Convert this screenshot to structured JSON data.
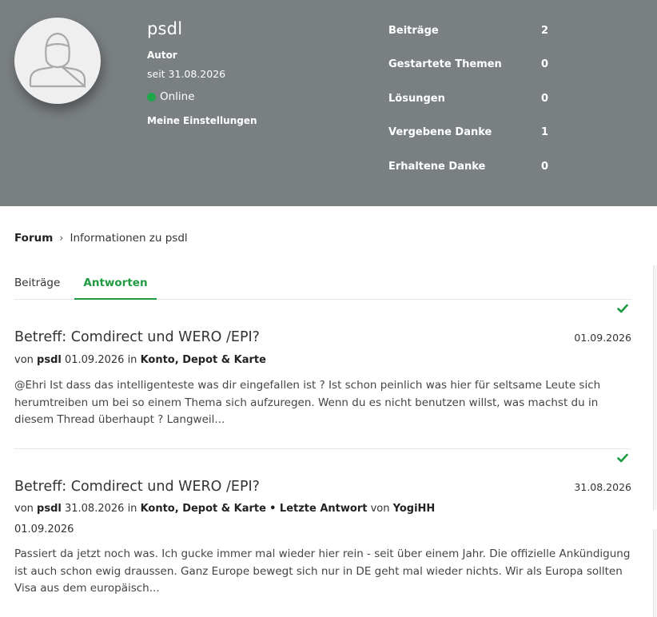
{
  "profile": {
    "username": "psdl",
    "role": "Autor",
    "since": "seit 31.08.2026",
    "status": "Online",
    "settings_link": "Meine Einstellungen",
    "stats": [
      {
        "label": "Beiträge",
        "value": "2"
      },
      {
        "label": "Gestartete Themen",
        "value": "0"
      },
      {
        "label": "Lösungen",
        "value": "0"
      },
      {
        "label": "Vergebene Danke",
        "value": "1"
      },
      {
        "label": "Erhaltene Danke",
        "value": "0"
      }
    ]
  },
  "breadcrumb": {
    "root": "Forum",
    "separator": "›",
    "current": "Informationen zu psdl"
  },
  "tabs": [
    {
      "label": "Beiträge",
      "active": false
    },
    {
      "label": "Antworten",
      "active": true
    }
  ],
  "posts": [
    {
      "title": "Betreff: Comdirect und WERO /EPI?",
      "date": "01.09.2026",
      "meta_prefix": "von",
      "author": "psdl",
      "meta_date": "01.09.2026",
      "meta_in": "in",
      "board": "Konto, Depot & Karte",
      "excerpt": "@Ehri Ist dass das intelligenteste was dir eingefallen ist ? Ist schon peinlich was hier für seltsame Leute sich herumtreiben um bei so einem Thema sich aufzuregen. Wenn du es nicht benutzen willst, was machst du in diesem Thread überhaupt ? Langweil..."
    },
    {
      "title": "Betreff: Comdirect und WERO /EPI?",
      "date": "31.08.2026",
      "meta_prefix": "von",
      "author": "psdl",
      "meta_date": "31.08.2026",
      "meta_in": "in",
      "board": "Konto, Depot & Karte",
      "last_reply_label": "• Letzte Antwort",
      "last_reply_von": "von",
      "last_reply_user": "YogiHH",
      "last_reply_date": "01.09.2026",
      "excerpt": "Passiert da jetzt noch was. Ich gucke immer mal wieder hier rein - seit über einem Jahr. Die offizielle Ankündigung ist auch schon ewig draussen. Ganz Europe bewegt sich nur in DE geht mal wieder nichts. Wir als Europa sollten Visa aus dem europäisch..."
    }
  ],
  "colors": {
    "header_bg": "#7a7f82",
    "accent_green": "#1f9a40",
    "online_dot": "#1fa64b"
  },
  "icons": {
    "avatar": "user-avatar-icon",
    "status": "online-dot-icon",
    "solved": "checkmark-icon"
  }
}
